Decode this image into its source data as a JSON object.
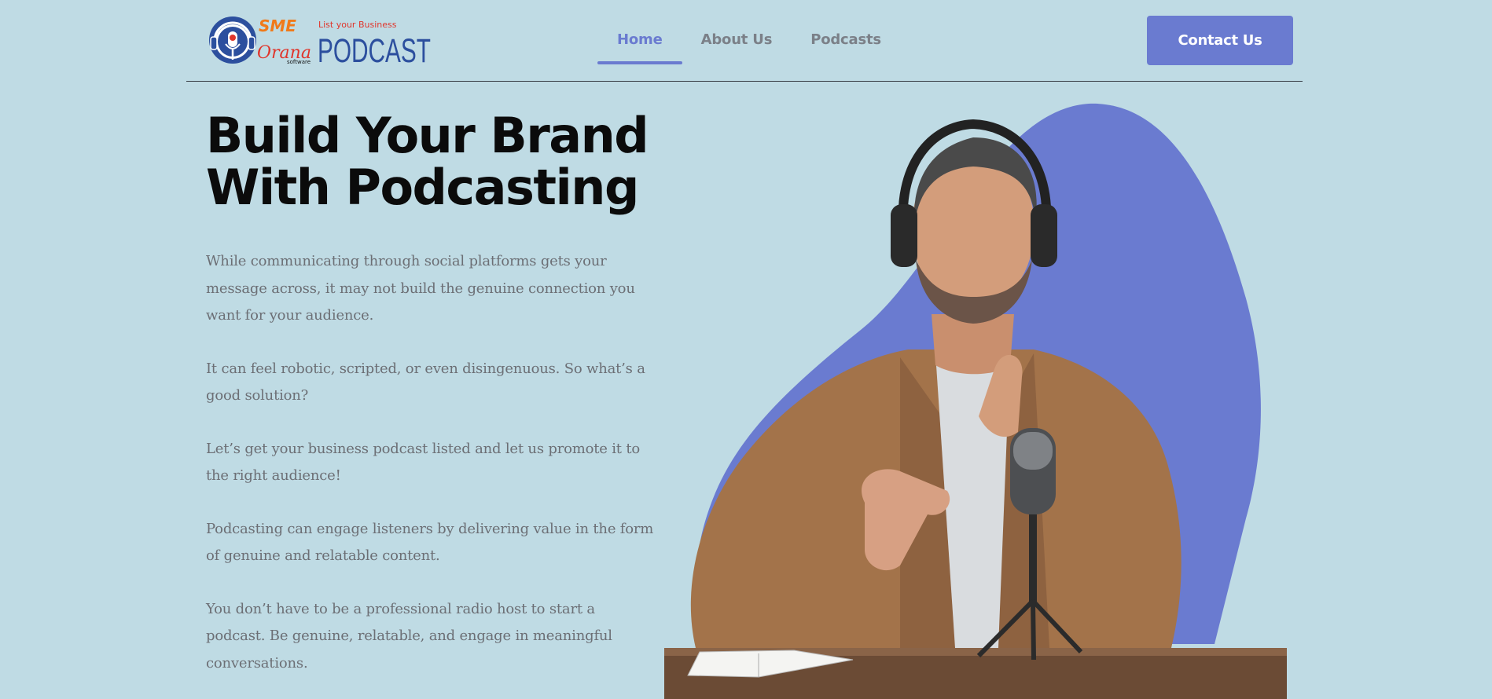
{
  "brand": {
    "logo_top_text": "SME",
    "logo_tagline": "List your Business",
    "logo_script": "Orana",
    "logo_small": "software",
    "logo_main": "PODCAST",
    "colors": {
      "accent": "#6a7bd0",
      "background": "#bfdbe4",
      "logo_blue": "#2c4f9e",
      "logo_orange": "#f07a1a",
      "logo_red": "#e0352b"
    }
  },
  "nav": {
    "items": [
      {
        "label": "Home",
        "active": true
      },
      {
        "label": "About Us",
        "active": false
      },
      {
        "label": "Podcasts",
        "active": false
      }
    ],
    "contact_label": "Contact Us"
  },
  "hero": {
    "title_line1": "Build Your Brand",
    "title_line2": "With Podcasting",
    "paragraphs": [
      "While communicating through social platforms gets your message across, it may not build the genuine connection you want for your audience.",
      "It can feel robotic, scripted, or even disingenuous. So what’s a good solution?",
      "Let’s get your business podcast listed and let us promote it to the right audience!",
      "Podcasting can engage listeners by delivering value in the form of genuine and relatable content.",
      "You don’t have to be a professional radio host to start a podcast. Be genuine, relatable, and engage in meaningful conversations."
    ],
    "image_icon": "podcaster-photo"
  }
}
